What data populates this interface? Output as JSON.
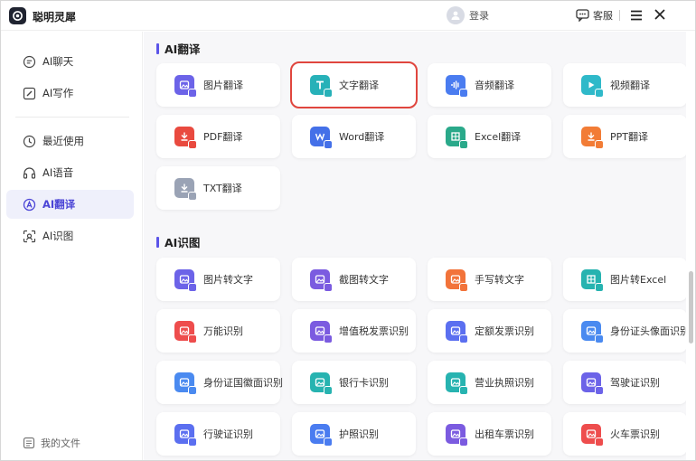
{
  "app": {
    "name": "聪明灵犀"
  },
  "header": {
    "login_label": "登录",
    "service_label": "客服"
  },
  "sidebar": {
    "items": [
      {
        "label": "AI聊天",
        "icon": "chat-icon"
      },
      {
        "label": "AI写作",
        "icon": "write-icon"
      },
      {
        "label": "最近使用",
        "icon": "clock-icon"
      },
      {
        "label": "AI语音",
        "icon": "headset-icon"
      },
      {
        "label": "AI翻译",
        "icon": "translate-icon",
        "active": true
      },
      {
        "label": "AI识图",
        "icon": "scan-icon"
      }
    ],
    "footer_label": "我的文件"
  },
  "sections": [
    {
      "title": "AI翻译",
      "cards": [
        {
          "label": "图片翻译",
          "icon": "image-icon",
          "color": "#6c63e8"
        },
        {
          "label": "文字翻译",
          "icon": "text-icon",
          "color": "#27b1b8",
          "selected": true
        },
        {
          "label": "音频翻译",
          "icon": "audio-icon",
          "color": "#4a7cf0"
        },
        {
          "label": "视频翻译",
          "icon": "video-icon",
          "color": "#2fb9c9"
        },
        {
          "label": "PDF翻译",
          "icon": "pdf-icon",
          "color": "#e94a3f"
        },
        {
          "label": "Word翻译",
          "icon": "word-icon",
          "color": "#4470e8"
        },
        {
          "label": "Excel翻译",
          "icon": "excel-icon",
          "color": "#2aa98a"
        },
        {
          "label": "PPT翻译",
          "icon": "ppt-icon",
          "color": "#f27c36"
        },
        {
          "label": "TXT翻译",
          "icon": "txt-icon",
          "color": "#9aa3b5"
        }
      ]
    },
    {
      "title": "AI识图",
      "cards": [
        {
          "label": "图片转文字",
          "icon": "image-text-icon",
          "color": "#6c63e8"
        },
        {
          "label": "截图转文字",
          "icon": "screenshot-icon",
          "color": "#7b5be0"
        },
        {
          "label": "手写转文字",
          "icon": "handwrite-icon",
          "color": "#f2733a"
        },
        {
          "label": "图片转Excel",
          "icon": "image-excel-icon",
          "color": "#27b3b0"
        },
        {
          "label": "万能识别",
          "icon": "universal-icon",
          "color": "#ee4d4d"
        },
        {
          "label": "增值税发票识别",
          "icon": "vat-invoice-icon",
          "color": "#7b5be0"
        },
        {
          "label": "定额发票识别",
          "icon": "quota-invoice-icon",
          "color": "#5b6ff0"
        },
        {
          "label": "身份证头像面识别",
          "icon": "id-front-icon",
          "color": "#4a8af0"
        },
        {
          "label": "身份证国徽面识别",
          "icon": "id-back-icon",
          "color": "#4a8af0"
        },
        {
          "label": "银行卡识别",
          "icon": "bank-card-icon",
          "color": "#27b3b0"
        },
        {
          "label": "营业执照识别",
          "icon": "license-icon",
          "color": "#27b3b0"
        },
        {
          "label": "驾驶证识别",
          "icon": "driver-license-icon",
          "color": "#6c63e8"
        },
        {
          "label": "行驶证识别",
          "icon": "vehicle-license-icon",
          "color": "#5b6ff0"
        },
        {
          "label": "护照识别",
          "icon": "passport-icon",
          "color": "#4a7cf0"
        },
        {
          "label": "出租车票识别",
          "icon": "taxi-ticket-icon",
          "color": "#7b5be0"
        },
        {
          "label": "火车票识别",
          "icon": "train-ticket-icon",
          "color": "#ee4d4d"
        }
      ]
    }
  ]
}
